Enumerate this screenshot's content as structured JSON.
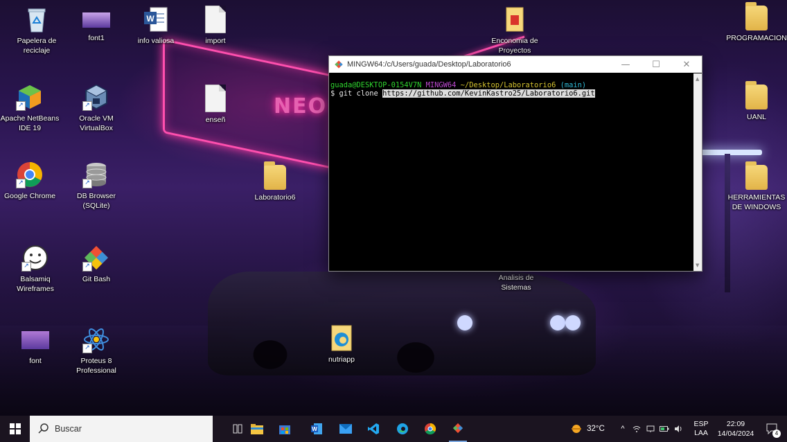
{
  "desktop": {
    "wallpaper_sign_text": "NEO GAS",
    "icons": [
      {
        "id": "recycle",
        "label": "Papelera de reciclaje"
      },
      {
        "id": "font1",
        "label": "font1"
      },
      {
        "id": "info",
        "label": "info valiosa"
      },
      {
        "id": "import",
        "label": "import"
      },
      {
        "id": "economia",
        "label": "Enconomia de Proyectos"
      },
      {
        "id": "programacion",
        "label": "PROGRAMACION"
      },
      {
        "id": "netbeans",
        "label": "Apache NetBeans IDE 19"
      },
      {
        "id": "virtualbox",
        "label": "Oracle VM VirtualBox"
      },
      {
        "id": "ensen",
        "label": "enseñ"
      },
      {
        "id": "uanl",
        "label": "UANL"
      },
      {
        "id": "chrome",
        "label": "Google Chrome"
      },
      {
        "id": "dbbrowser",
        "label": "DB Browser (SQLite)"
      },
      {
        "id": "laboratorio6",
        "label": "Laboratorio6"
      },
      {
        "id": "herramientas",
        "label": "HERRAMIENTAS DE WINDOWS"
      },
      {
        "id": "balsamiq",
        "label": "Balsamiq Wireframes"
      },
      {
        "id": "gitbash",
        "label": "Git Bash"
      },
      {
        "id": "analisis",
        "label": "Analisis de Sistemas"
      },
      {
        "id": "font",
        "label": "font"
      },
      {
        "id": "proteus",
        "label": "Proteus 8 Professional"
      },
      {
        "id": "nutriapp",
        "label": "nutriapp"
      }
    ]
  },
  "terminal": {
    "title": "MINGW64:/c/Users/guada/Desktop/Laboratorio6",
    "minimize": "—",
    "maximize": "☐",
    "close": "✕",
    "prompt_user": "guada@DESKTOP-0154V7N",
    "prompt_env": "MINGW64",
    "prompt_path": "~/Desktop/Laboratorio6",
    "prompt_branch": "(main)",
    "command_prefix": "$ git clone ",
    "command_url": "https://github.com/KevinKastro25/Laboratorio6.git"
  },
  "taskbar": {
    "search_placeholder": "Buscar",
    "weather_temp": "32°C",
    "language": "ESP",
    "keyboard": "LAA",
    "time": "22:09",
    "date": "14/04/2024",
    "notification_count": "4",
    "apps": [
      "task-view",
      "file-explorer",
      "microsoft-store",
      "word",
      "mail",
      "vscode",
      "edge",
      "chrome",
      "git"
    ]
  },
  "colors": {
    "terminal_green": "#2fd42f",
    "terminal_magenta": "#c04ad4",
    "terminal_yellow": "#d4c22f",
    "terminal_cyan": "#2fb8d4",
    "taskbar": "#1b1420"
  }
}
